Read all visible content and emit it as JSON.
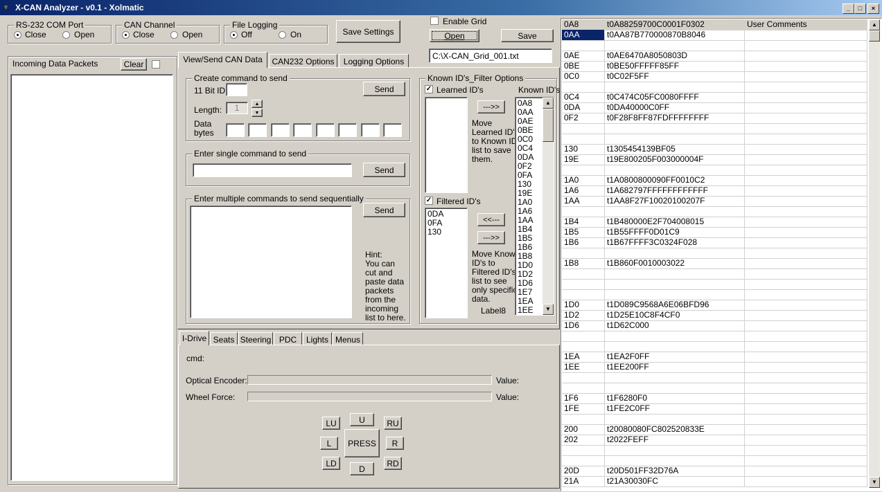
{
  "window": {
    "title": "X-CAN  Analyzer - v0.1 - Xolmatic"
  },
  "com_port": {
    "title": "RS-232 COM Port",
    "opt_close": "Close",
    "opt_open": "Open",
    "selected": "Close"
  },
  "can_channel": {
    "title": "CAN Channel",
    "opt_close": "Close",
    "opt_open": "Open",
    "selected": "Close"
  },
  "file_logging": {
    "title": "File Logging",
    "opt_off": "Off",
    "opt_on": "On",
    "selected": "Off"
  },
  "save_settings": "Save Settings",
  "grid_controls": {
    "enable_grid": "Enable Grid",
    "open": "Open",
    "save": "Save",
    "file_path": "C:\\X-CAN_Grid_001.txt"
  },
  "incoming": {
    "title": "Incoming Data Packets",
    "clear": "Clear"
  },
  "tabs": {
    "view_send": "View/Send CAN Data",
    "can232": "CAN232 Options",
    "logging": "Logging Options"
  },
  "create_cmd": {
    "title": "Create command to send",
    "id_label": "11 Bit ID:",
    "length_label": "Length:",
    "length_value": "1",
    "data_label_1": "Data",
    "data_label_2": "bytes",
    "send": "Send"
  },
  "single_cmd": {
    "title": "Enter single command to send",
    "send": "Send"
  },
  "multi_cmd": {
    "title": "Enter multiple commands to send sequentially",
    "send": "Send",
    "hint": [
      "Hint:",
      "You can",
      "cut and",
      "paste data",
      "packets",
      "from the",
      "incoming",
      "list to here."
    ]
  },
  "known_ids": {
    "title": "Known ID's_Filter Options",
    "learned_label": "Learned ID's",
    "known_label": "Known ID's",
    "filtered_label": "Filtered ID's",
    "btn_forward": "--->>",
    "btn_back": "<<---",
    "btn_forward2": "--->>",
    "move_learned": [
      "Move",
      "Learned ID's",
      "to Known ID",
      "list to save",
      "them."
    ],
    "move_known": [
      "Move Known",
      "ID's to",
      "Filtered ID's",
      "list to see",
      "only specific",
      "data."
    ],
    "label8": "Label8",
    "known_list": [
      "0A8",
      "0AA",
      "0AE",
      "0BE",
      "0C0",
      "0C4",
      "0DA",
      "0F2",
      "0FA",
      "130",
      "19E",
      "1A0",
      "1A6",
      "1AA",
      "1B4",
      "1B5",
      "1B6",
      "1B8",
      "1D0",
      "1D2",
      "1D6",
      "1E7",
      "1EA",
      "1EE"
    ],
    "filtered_list": [
      "0DA",
      "0FA",
      "130"
    ]
  },
  "bottom_tabs": [
    "I-Drive",
    "Seats",
    "Steering",
    "PDC",
    "Lights",
    "Menus"
  ],
  "idrive": {
    "cmd_label": "cmd:",
    "optical_label": "Optical Encoder:",
    "wheel_label": "Wheel Force:",
    "value_label": "Value:",
    "value_label2": "Value:",
    "pad": {
      "lu": "LU",
      "u": "U",
      "ru": "RU",
      "l": "L",
      "press": "PRESS",
      "r": "R",
      "ld": "LD",
      "d": "D",
      "rd": "RD"
    }
  },
  "grid": {
    "col3_header": "User Comments",
    "rows": [
      [
        "0A8",
        "t0A88259700C0001F0302"
      ],
      [
        "0AA",
        "t0AA87B770000870B8046"
      ],
      [
        "",
        ""
      ],
      [
        "0AE",
        "t0AE6470A8050803D"
      ],
      [
        "0BE",
        "t0BE50FFFFF85FF"
      ],
      [
        "0C0",
        "t0C02F5FF"
      ],
      [
        "",
        ""
      ],
      [
        "0C4",
        "t0C474C05FC0080FFFF"
      ],
      [
        "0DA",
        "t0DA40000C0FF"
      ],
      [
        "0F2",
        "t0F28F8FF87FDFFFFFFFF"
      ],
      [
        "",
        ""
      ],
      [
        "",
        ""
      ],
      [
        "130",
        "t1305454139BF05"
      ],
      [
        "19E",
        "t19E800205F003000004F"
      ],
      [
        "",
        ""
      ],
      [
        "1A0",
        "t1A0800800090FF0010C2"
      ],
      [
        "1A6",
        "t1A682797FFFFFFFFFFFF"
      ],
      [
        "1AA",
        "t1AA8F27F10020100207F"
      ],
      [
        "",
        ""
      ],
      [
        "1B4",
        "t1B480000E2F704008015"
      ],
      [
        "1B5",
        "t1B55FFFF0D01C9"
      ],
      [
        "1B6",
        "t1B67FFFF3C0324F028"
      ],
      [
        "",
        ""
      ],
      [
        "1B8",
        "t1B860F0010003022"
      ],
      [
        "",
        ""
      ],
      [
        "",
        ""
      ],
      [
        "",
        ""
      ],
      [
        "1D0",
        "t1D089C9568A6E06BFD96"
      ],
      [
        "1D2",
        "t1D25E10C8F4CF0"
      ],
      [
        "1D6",
        "t1D62C000"
      ],
      [
        "",
        ""
      ],
      [
        "",
        ""
      ],
      [
        "1EA",
        "t1EA2F0FF"
      ],
      [
        "1EE",
        "t1EE200FF"
      ],
      [
        "",
        ""
      ],
      [
        "",
        ""
      ],
      [
        "1F6",
        "t1F6280F0"
      ],
      [
        "1FE",
        "t1FE2C0FF"
      ],
      [
        "",
        ""
      ],
      [
        "200",
        "t20080080FC802520833E"
      ],
      [
        "202",
        "t2022FEFF"
      ],
      [
        "",
        ""
      ],
      [
        "",
        ""
      ],
      [
        "20D",
        "t20D501FF32D76A"
      ],
      [
        "21A",
        "t21A30030FC"
      ]
    ]
  }
}
